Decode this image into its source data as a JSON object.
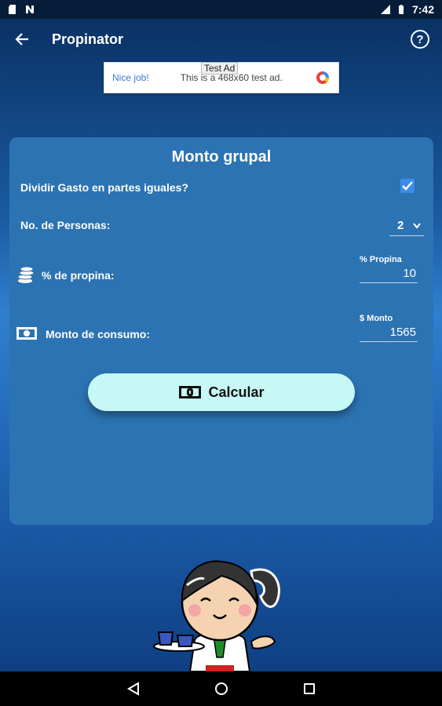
{
  "status": {
    "time": "7:42"
  },
  "appbar": {
    "title": "Propinator"
  },
  "ad": {
    "tag": "Test Ad",
    "nice": "Nice job!",
    "text": "This is a 468x60 test ad."
  },
  "card": {
    "title": "Monto grupal",
    "split_label": "Dividir Gasto en partes iguales?",
    "split_checked": true,
    "persons_label": "No. de Personas:",
    "persons_value": "2",
    "tip_label": "% de propina:",
    "tip_hint": "% Propina",
    "tip_value": "10",
    "amount_label": "Monto de consumo:",
    "amount_hint": "$ Monto",
    "amount_value": "1565",
    "calc_label": "Calcular"
  },
  "colors": {
    "accent": "#c6f8f6",
    "card": "#2c73b3",
    "check": "#3b8ee8"
  },
  "icons": [
    "back-arrow-icon",
    "help-icon",
    "coins-icon",
    "banknote-icon",
    "calculator-bill-icon",
    "nav-back-icon",
    "nav-home-icon",
    "nav-recents-icon"
  ]
}
